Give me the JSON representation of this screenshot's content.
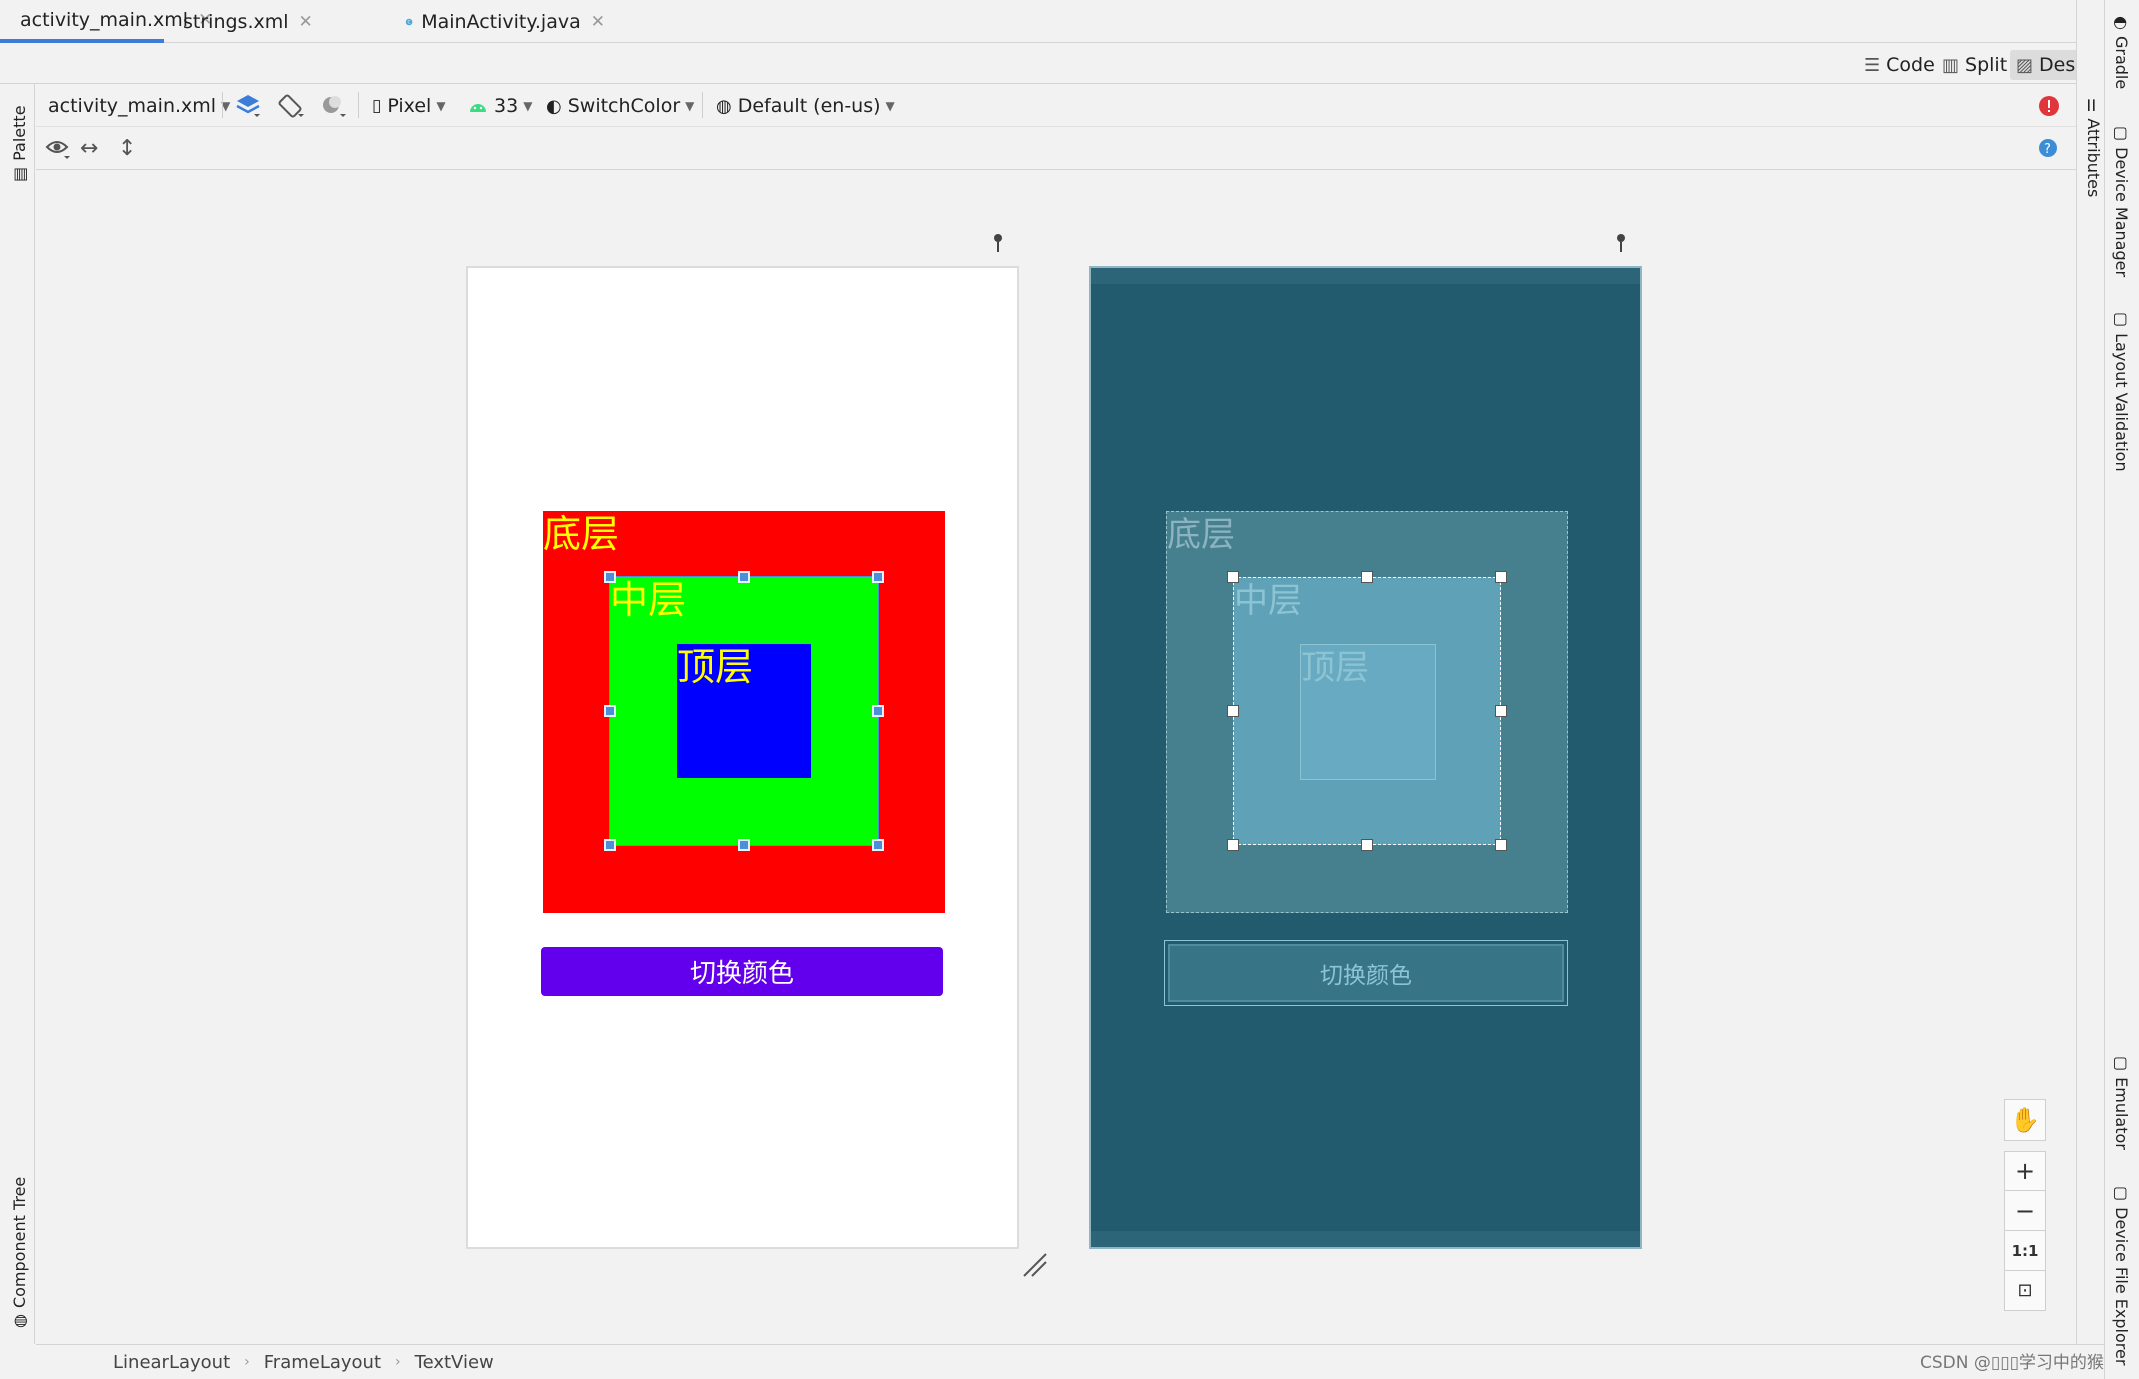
{
  "tabs": [
    {
      "label": "activity_main.xml",
      "active": true,
      "icon": "xml-file-icon"
    },
    {
      "label": "strings.xml",
      "active": false,
      "icon": "xml-file-icon"
    },
    {
      "label": "MainActivity.java",
      "active": false,
      "icon": "java-class-icon"
    }
  ],
  "view_modes": {
    "code": "Code",
    "split": "Split",
    "design": "Design",
    "active": "Design"
  },
  "toolbar": {
    "file": "activity_main.xml",
    "device": "Pixel",
    "api": "33",
    "theme": "SwitchColor",
    "locale": "Default (en-us)"
  },
  "left_panels": {
    "palette": "Palette",
    "component_tree": "Component Tree"
  },
  "right_panels": {
    "gradle": "Gradle",
    "attributes": "Attributes",
    "device_manager": "Device Manager",
    "layout_validation": "Layout Validation",
    "emulator": "Emulator",
    "device_file_explorer": "Device File Explorer"
  },
  "design_preview": {
    "bottom_label": "底层",
    "middle_label": "中层",
    "top_label": "顶层",
    "button_label": "切换颜色"
  },
  "blueprint_preview": {
    "bottom_label": "底层",
    "middle_label": "中层",
    "top_label": "顶层",
    "button_label": "切换颜色"
  },
  "breadcrumb": [
    "LinearLayout",
    "FrameLayout",
    "TextView"
  ],
  "zoom_controls": {
    "fit": "1:1"
  },
  "watermark": "CSDN @▯▯▯学习中的猴",
  "colors": {
    "bottom_layer": "#ff0000",
    "middle_layer": "#00ff00",
    "top_layer": "#0000ff",
    "label_text": "#ffff00",
    "button": "#6200ee",
    "blueprint_bg": "#235b6e",
    "accent": "#3b7dd8"
  }
}
